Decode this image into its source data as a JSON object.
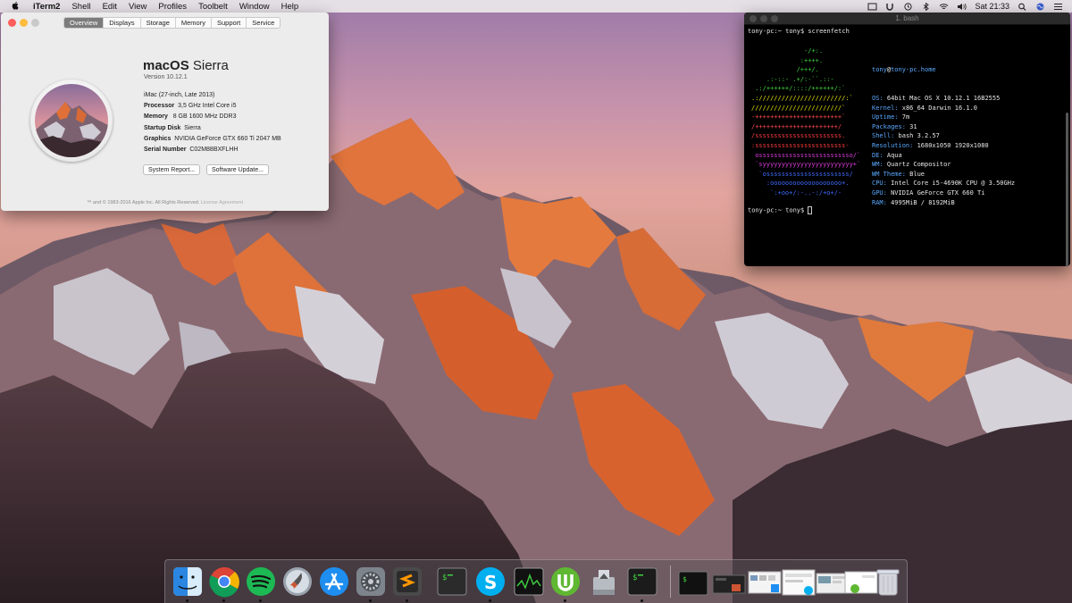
{
  "menubar": {
    "apple_glyph": "",
    "app_name": "iTerm2",
    "items": [
      "Shell",
      "Edit",
      "View",
      "Profiles",
      "Toolbelt",
      "Window",
      "Help"
    ],
    "clock": "Sat 21:33"
  },
  "about_window": {
    "tabs": [
      "Overview",
      "Displays",
      "Storage",
      "Memory",
      "Support",
      "Service"
    ],
    "active_tab": "Overview",
    "os_name_bold": "macOS",
    "os_name_rest": " Sierra",
    "version": "Version 10.12.1",
    "model": "iMac (27-inch, Late 2013)",
    "specs": [
      {
        "key": "Processor",
        "value": "3,5 GHz Intel Core i5"
      },
      {
        "key": "Memory",
        "value": "8 GB 1600 MHz DDR3"
      },
      {
        "key": "Startup Disk",
        "value": "Sierra"
      },
      {
        "key": "Graphics",
        "value": "NVIDIA GeForce GTX 660 Ti 2047 MB"
      },
      {
        "key": "Serial Number",
        "value": "C02M88BXFLHH"
      }
    ],
    "system_report_button": "System Report...",
    "software_update_button": "Software Update...",
    "footer_text": "™ and © 1983-2016 Apple Inc. All Rights Reserved.",
    "footer_link": "License Agreement"
  },
  "terminal": {
    "title": "1. bash",
    "command_line": "tony-pc:~ tony$ screenfetch",
    "prompt": "tony-pc:~ tony$ ",
    "art_lines": [
      {
        "text": "              -/+:.",
        "color": "#3fd13f"
      },
      {
        "text": "             :++++.",
        "color": "#3fd13f"
      },
      {
        "text": "            /+++/.",
        "color": "#3fd13f"
      },
      {
        "text": "    .:-::- .+/:-``.::-",
        "color": "#3fd13f"
      },
      {
        "text": " .:/++++++/::::/++++++/:`",
        "color": "#3fd13f"
      },
      {
        "text": ".:///////////////////////:`",
        "color": "#e6e600"
      },
      {
        "text": "////////////////////////`",
        "color": "#e6e600"
      },
      {
        "text": "-+++++++++++++++++++++++`",
        "color": "#ff4a4a"
      },
      {
        "text": "/++++++++++++++++++++++/",
        "color": "#ff4a4a"
      },
      {
        "text": "/sssssssssssssssssssssss.",
        "color": "#ff3b3b"
      },
      {
        "text": ":ssssssssssssssssssssssss-",
        "color": "#ff3b3b"
      },
      {
        "text": " osssssssssssssssssssssssso/`",
        "color": "#d93cd9"
      },
      {
        "text": " `syyyyyyyyyyyyyyyyyyyyyyyy+`",
        "color": "#d93cd9"
      },
      {
        "text": "  `ossssssssssssssssssssss/",
        "color": "#3d6bff"
      },
      {
        "text": "    :ooooooooooooooooooo+.",
        "color": "#3d6bff"
      },
      {
        "text": "     `:+oo+/:-..-:/+o+/-",
        "color": "#3d6bff"
      }
    ],
    "user_host_user": "tony",
    "user_host_at": "@",
    "user_host_host": "tony-pc.home",
    "info": [
      {
        "key": "OS:",
        "value": " 64bit Mac OS X 10.12.1 16B2555"
      },
      {
        "key": "Kernel:",
        "value": " x86_64 Darwin 16.1.0"
      },
      {
        "key": "Uptime:",
        "value": " 7m"
      },
      {
        "key": "Packages:",
        "value": " 31"
      },
      {
        "key": "Shell:",
        "value": " bash 3.2.57"
      },
      {
        "key": "Resolution:",
        "value": " 1680x1050 1920x1080"
      },
      {
        "key": "DE:",
        "value": " Aqua"
      },
      {
        "key": "WM:",
        "value": " Quartz Compositor"
      },
      {
        "key": "WM Theme:",
        "value": " Blue"
      },
      {
        "key": "CPU:",
        "value": " Intel Core i5-4690K CPU @ 3.50GHz"
      },
      {
        "key": "GPU:",
        "value": " NVIDIA GeForce GTX 660 Ti"
      },
      {
        "key": "RAM:",
        "value": " 4995MiB / 8192MiB"
      }
    ]
  },
  "dock": {
    "apps": [
      {
        "name": "finder-icon",
        "running": true
      },
      {
        "name": "chrome-icon",
        "running": true
      },
      {
        "name": "spotify-icon",
        "running": true
      },
      {
        "name": "launchpad-icon",
        "running": false
      },
      {
        "name": "app-store-icon",
        "running": false
      },
      {
        "name": "system-preferences-icon",
        "running": true
      },
      {
        "name": "sublime-text-icon",
        "running": true
      },
      {
        "name": "terminal-icon",
        "running": false
      },
      {
        "name": "skype-icon",
        "running": true
      },
      {
        "name": "activity-monitor-icon",
        "running": false
      },
      {
        "name": "utorrent-icon",
        "running": true
      },
      {
        "name": "disk-utility-icon",
        "running": false
      },
      {
        "name": "iterm-icon",
        "running": true
      }
    ],
    "minimized": [
      "minimized-terminal",
      "minimized-window-1",
      "minimized-window-2",
      "minimized-window-3",
      "minimized-window-4",
      "minimized-window-5"
    ],
    "trash": "trash-icon"
  }
}
